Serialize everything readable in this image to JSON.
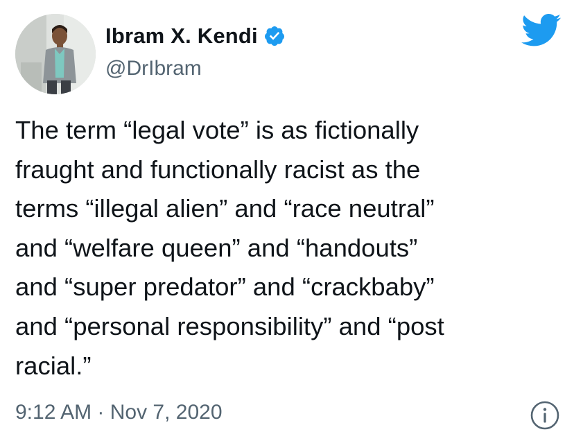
{
  "author": {
    "display_name": "Ibram X. Kendi",
    "handle": "@DrIbram",
    "verified": true,
    "avatar": "avatar-photo"
  },
  "tweet": {
    "text": "The term “legal vote” is as fictionally\nfraught and functionally racist as the\nterms “illegal alien” and “race neutral”\nand “welfare queen” and “handouts”\nand “super predator” and “crackbaby”\nand “personal responsibility” and “post\nracial.”",
    "timestamp": "9:12 AM · Nov 7, 2020"
  },
  "icons": {
    "verified": "verified-badge-icon",
    "brand": "twitter-bird-icon",
    "info": "info-icon"
  },
  "colors": {
    "brand_blue": "#1d9bf0",
    "text_primary": "#0f1419",
    "text_secondary": "#536471"
  }
}
